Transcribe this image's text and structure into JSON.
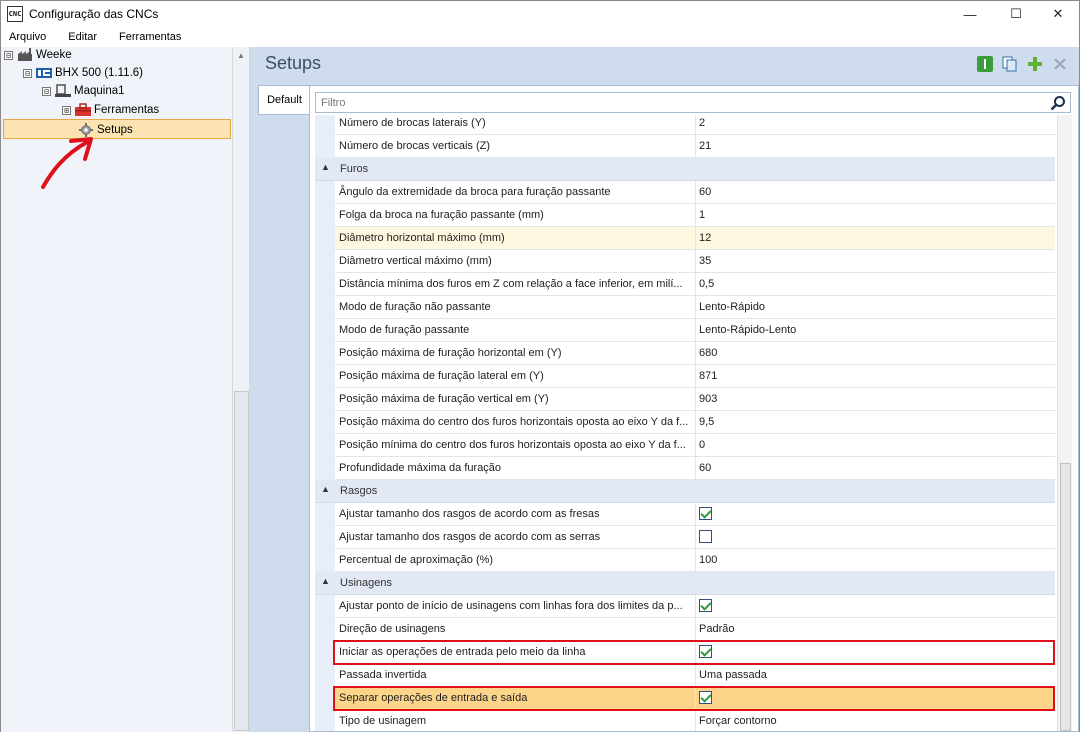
{
  "window": {
    "app_icon_text": "CNC",
    "title": "Configuração das CNCs",
    "controls": {
      "minimize": "—",
      "maximize": "☐",
      "close": "✕"
    }
  },
  "menu": [
    "Arquivo",
    "Editar",
    "Ferramentas"
  ],
  "tree": {
    "items": [
      {
        "label": "Weeke",
        "expander": "⊟"
      },
      {
        "label": "BHX 500 (1.11.6)",
        "expander": "⊟"
      },
      {
        "label": "Maquina1",
        "expander": "⊟"
      },
      {
        "label": "Ferramentas",
        "expander": "⊞"
      },
      {
        "label": "Setups"
      }
    ]
  },
  "header": {
    "title": "Setups"
  },
  "tabs": [
    {
      "label": "Default"
    }
  ],
  "filter": {
    "placeholder": "Filtro"
  },
  "grid": [
    {
      "kind": "prop",
      "name": "Número de brocas laterais (Y)",
      "value": "2"
    },
    {
      "kind": "prop",
      "name": "Número de brocas verticais (Z)",
      "value": "21"
    },
    {
      "kind": "cat",
      "name": "Furos"
    },
    {
      "kind": "prop",
      "name": "Ângulo da extremidade da broca para furação passante",
      "value": "60"
    },
    {
      "kind": "prop",
      "name": "Folga da broca na furação passante (mm)",
      "value": "1"
    },
    {
      "kind": "prop",
      "name": "Diâmetro horizontal máximo (mm)",
      "value": "12",
      "highlight": "yellow"
    },
    {
      "kind": "prop",
      "name": "Diâmetro vertical máximo (mm)",
      "value": "35"
    },
    {
      "kind": "prop",
      "name": "Distância mínima dos furos em Z com relação a face inferior, em milí...",
      "value": "0,5"
    },
    {
      "kind": "prop",
      "name": "Modo de furação não passante",
      "value": "Lento-Rápido"
    },
    {
      "kind": "prop",
      "name": "Modo de furação passante",
      "value": "Lento-Rápido-Lento"
    },
    {
      "kind": "prop",
      "name": "Posição máxima de furação horizontal em (Y)",
      "value": "680"
    },
    {
      "kind": "prop",
      "name": "Posição máxima de furação lateral em (Y)",
      "value": "871"
    },
    {
      "kind": "prop",
      "name": "Posição máxima de furação vertical em (Y)",
      "value": "903"
    },
    {
      "kind": "prop",
      "name": "Posição máxima do centro dos furos horizontais oposta ao eixo Y da f...",
      "value": "9,5"
    },
    {
      "kind": "prop",
      "name": "Posição mínima do centro dos furos horizontais oposta ao eixo Y da f...",
      "value": "0"
    },
    {
      "kind": "prop",
      "name": "Profundidade máxima da furação",
      "value": "60"
    },
    {
      "kind": "cat",
      "name": "Rasgos"
    },
    {
      "kind": "check",
      "name": "Ajustar tamanho dos rasgos de acordo com as fresas",
      "checked": true
    },
    {
      "kind": "check",
      "name": "Ajustar tamanho dos rasgos de acordo com as serras",
      "checked": false
    },
    {
      "kind": "prop",
      "name": "Percentual de aproximação (%)",
      "value": "100"
    },
    {
      "kind": "cat",
      "name": "Usinagens"
    },
    {
      "kind": "check",
      "name": "Ajustar ponto de início de usinagens com linhas fora dos limites da p...",
      "checked": true
    },
    {
      "kind": "prop",
      "name": "Direção de usinagens",
      "value": "Padrão"
    },
    {
      "kind": "check",
      "name": "Iniciar as operações de entrada pelo meio da linha",
      "checked": true,
      "boxed": true
    },
    {
      "kind": "prop",
      "name": "Passada invertida",
      "value": "Uma passada"
    },
    {
      "kind": "check",
      "name": "Separar operações de entrada e saída",
      "checked": true,
      "boxed": true,
      "highlight": "orange"
    },
    {
      "kind": "prop",
      "name": "Tipo de usinagem",
      "value": "Forçar contorno"
    }
  ],
  "colors": {
    "accent": "#e0101a",
    "selection": "#fbe3b2",
    "highlight": "#fdd58a"
  }
}
